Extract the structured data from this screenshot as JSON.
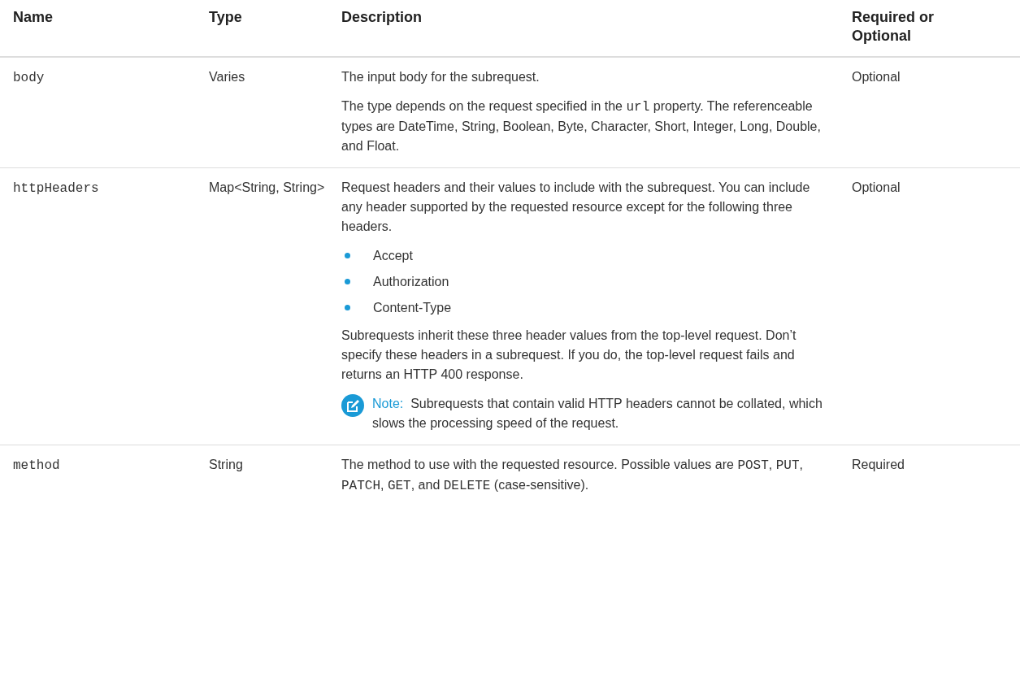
{
  "table": {
    "columns": [
      "Name",
      "Type",
      "Description",
      "Required or Optional"
    ],
    "rows": [
      {
        "name": "body",
        "type": "Varies",
        "requirement": "Optional",
        "description": [
          {
            "kind": "paragraph",
            "segments": [
              {
                "text": "The input body for the subrequest.",
                "code": false
              }
            ]
          },
          {
            "kind": "paragraph",
            "segments": [
              {
                "text": "The type depends on the request specified in the ",
                "code": false
              },
              {
                "text": "url",
                "code": true
              },
              {
                "text": " property. The referenceable types are DateTime, String, Boolean, Byte, Character, Short, Integer, Long, Double, and Float.",
                "code": false
              }
            ]
          }
        ]
      },
      {
        "name": "httpHeaders",
        "type": "Map<String, String>",
        "requirement": "Optional",
        "description": [
          {
            "kind": "paragraph",
            "segments": [
              {
                "text": "Request headers and their values to include with the subrequest. You can include any header supported by the requested resource except for the following three headers.",
                "code": false
              }
            ]
          },
          {
            "kind": "bullets",
            "items": [
              "Accept",
              "Authorization",
              "Content-Type"
            ]
          },
          {
            "kind": "paragraph",
            "segments": [
              {
                "text": "Subrequests inherit these three header values from the top-level request. Don’t specify these headers in a subrequest. If you do, the top-level request fails and returns an HTTP 400 response.",
                "code": false
              }
            ]
          },
          {
            "kind": "note",
            "label": "Note:",
            "text": "Subrequests that contain valid HTTP headers cannot be collated, which slows the processing speed of the request."
          }
        ]
      },
      {
        "name": "method",
        "type": "String",
        "requirement": "Required",
        "description": [
          {
            "kind": "paragraph",
            "segments": [
              {
                "text": "The method to use with the requested resource. Possible values are ",
                "code": false
              },
              {
                "text": "POST",
                "code": true
              },
              {
                "text": ", ",
                "code": false
              },
              {
                "text": "PUT",
                "code": true
              },
              {
                "text": ", ",
                "code": false
              },
              {
                "text": "PATCH",
                "code": true
              },
              {
                "text": ", ",
                "code": false
              },
              {
                "text": "GET",
                "code": true
              },
              {
                "text": ", and ",
                "code": false
              },
              {
                "text": "DELETE",
                "code": true
              },
              {
                "text": " (case-sensitive).",
                "code": false
              }
            ]
          }
        ]
      }
    ]
  }
}
